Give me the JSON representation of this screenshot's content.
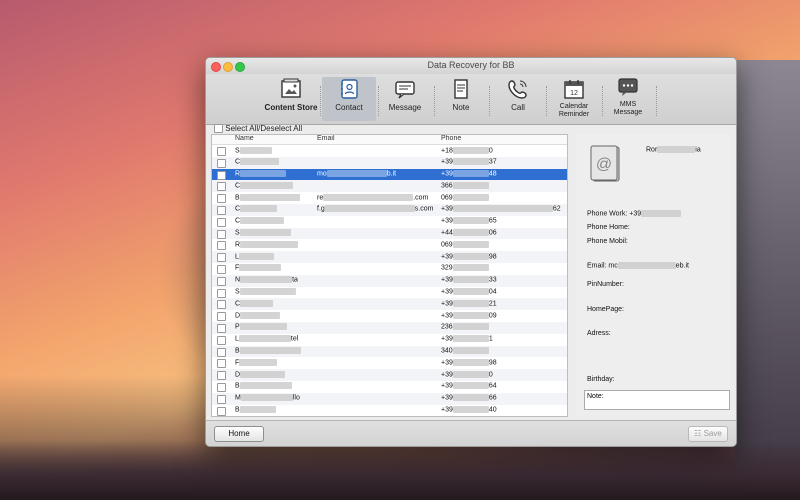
{
  "window": {
    "title": "Data Recovery for BB"
  },
  "toolbar": {
    "items": [
      {
        "label": "Content Store",
        "icon": "content-store-icon"
      },
      {
        "label": "Contact",
        "icon": "contact-book-icon"
      },
      {
        "label": "Message",
        "icon": "message-icon"
      },
      {
        "label": "Note",
        "icon": "note-icon"
      },
      {
        "label": "Call",
        "icon": "phone-icon"
      },
      {
        "label": "Calendar\nReminder",
        "icon": "calendar-icon"
      },
      {
        "label": "MMS\nMessage",
        "icon": "mms-icon"
      }
    ]
  },
  "select_all_label": "Select All/Deselect All",
  "table": {
    "headers": {
      "name": "Name",
      "email": "Email",
      "phone": "Phone"
    },
    "rows": [
      {
        "name": "S",
        "email": "",
        "phone_start": "+18",
        "phone_end": "0"
      },
      {
        "name": "C",
        "email": "",
        "phone_start": "+39",
        "phone_end": "37"
      },
      {
        "name": "R",
        "email": "mo",
        "email_end": "b.it",
        "phone_start": "+39",
        "phone_end": "48",
        "selected": true
      },
      {
        "name": "C",
        "email": "",
        "phone_start": "366",
        "phone_end": ""
      },
      {
        "name": "B",
        "email": "re",
        "email_end": ".com",
        "phone_start": "069",
        "phone_end": ""
      },
      {
        "name": "C",
        "email": "f.g",
        "email_end": "s.com",
        "phone_start": "+39",
        "phone_end": "62"
      },
      {
        "name": "C",
        "email": "",
        "phone_start": "+39",
        "phone_end": "65"
      },
      {
        "name": "S",
        "email": "",
        "phone_start": "+44",
        "phone_end": "06"
      },
      {
        "name": "R",
        "email": "",
        "phone_start": "069",
        "phone_end": ""
      },
      {
        "name": "L",
        "email": "",
        "phone_start": "+39",
        "phone_end": "98"
      },
      {
        "name": "F",
        "email": "",
        "phone_start": "329",
        "phone_end": ""
      },
      {
        "name": "N",
        "name_end": "ta",
        "email": "",
        "phone_start": "+39",
        "phone_end": "33"
      },
      {
        "name": "S",
        "email": "",
        "phone_start": "+39",
        "phone_end": "04"
      },
      {
        "name": "C",
        "email": "",
        "phone_start": "+39",
        "phone_end": "21"
      },
      {
        "name": "D",
        "email": "",
        "phone_start": "+39",
        "phone_end": "09"
      },
      {
        "name": "P",
        "email": "",
        "phone_start": "236",
        "phone_end": ""
      },
      {
        "name": "L",
        "name_end": "tel",
        "email": "",
        "phone_start": "+39",
        "phone_end": "1"
      },
      {
        "name": "B",
        "email": "",
        "phone_start": "340",
        "phone_end": ""
      },
      {
        "name": "F",
        "email": "",
        "phone_start": "+39",
        "phone_end": "98"
      },
      {
        "name": "D",
        "email": "",
        "phone_start": "+39",
        "phone_end": "0"
      },
      {
        "name": "B",
        "email": "",
        "phone_start": "+39",
        "phone_end": "64"
      },
      {
        "name": "M",
        "name_end": "llo",
        "email": "",
        "phone_start": "+39",
        "phone_end": "66"
      },
      {
        "name": "B",
        "email": "",
        "phone_start": "+39",
        "phone_end": "40"
      }
    ]
  },
  "detail": {
    "name_start": "Ror",
    "name_end": "ia",
    "fields": {
      "phone_work": "Phone Work:",
      "phone_work_value": "+39",
      "phone_home": "Phone Home:",
      "phone_mobil": "Phone Mobil:",
      "email": "Email:",
      "email_value_start": "mc",
      "email_value_end": "eb.it",
      "pin": "PinNumber:",
      "homepage": "HomePage:",
      "adress": "Adress:",
      "birthday": "Birthday:",
      "note": "Note:"
    }
  },
  "buttons": {
    "home": "Home",
    "save": "Save"
  },
  "colors": {
    "selection": "#2f6fd1",
    "close": "#fc605c",
    "minimize": "#fdbc40",
    "zoom": "#34c84a"
  }
}
